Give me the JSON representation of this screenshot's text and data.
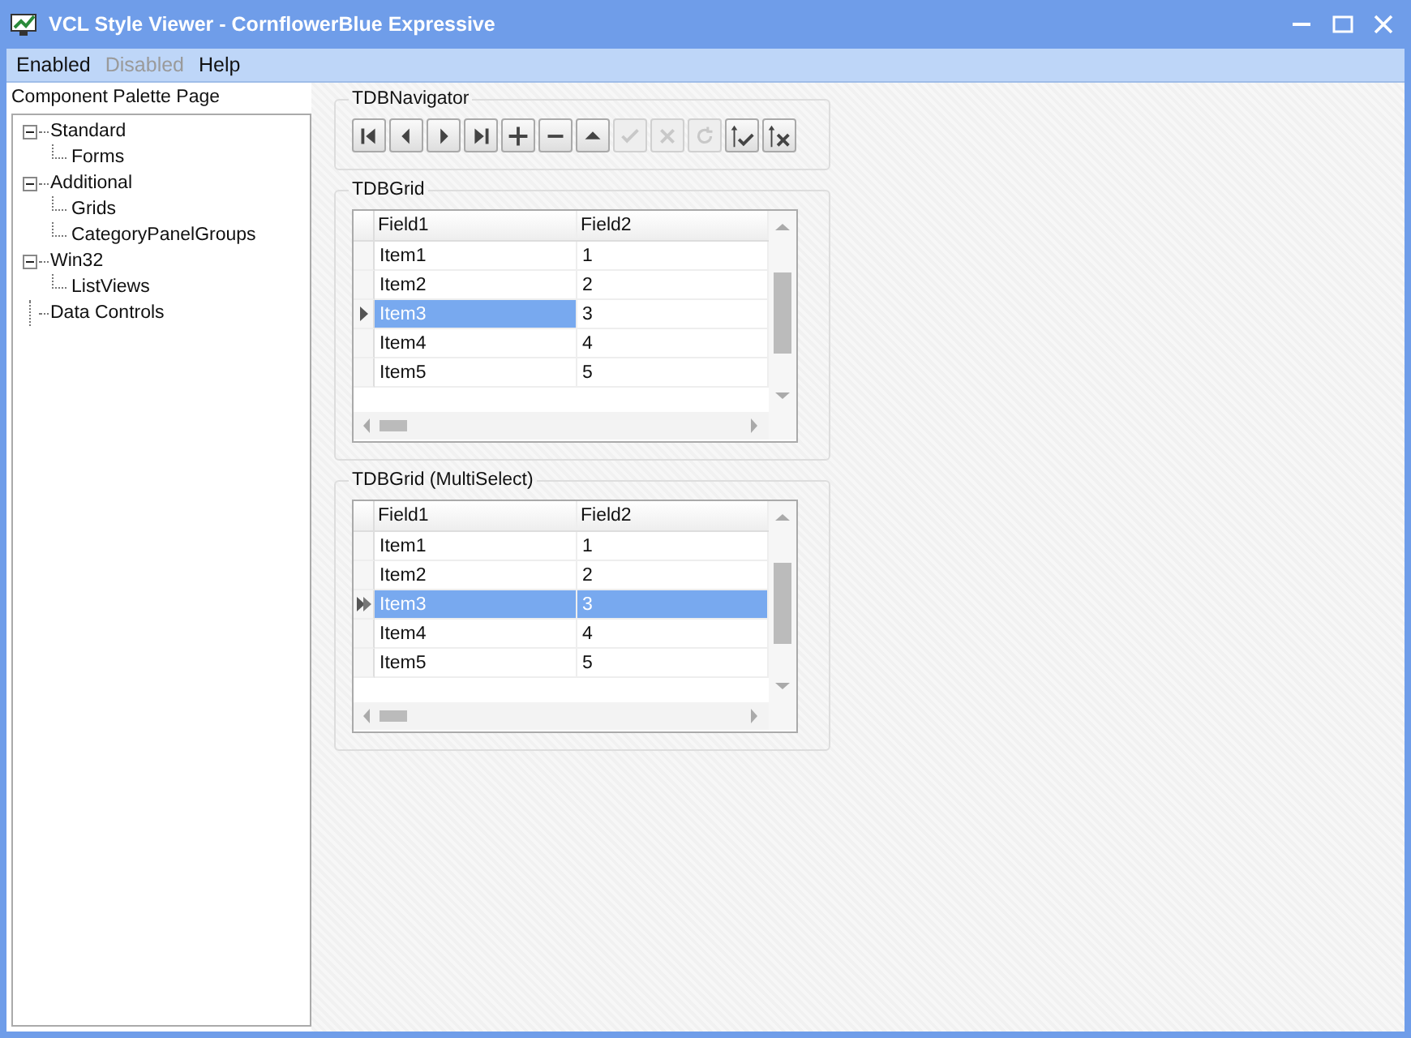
{
  "window": {
    "title": "VCL Style Viewer - CornflowerBlue Expressive"
  },
  "menu": [
    {
      "label": "Enabled",
      "disabled": false
    },
    {
      "label": "Disabled",
      "disabled": true
    },
    {
      "label": "Help",
      "disabled": false
    }
  ],
  "sidebar": {
    "title": "Component Palette Page",
    "tree": [
      {
        "label": "Standard",
        "expanded": true,
        "children": [
          {
            "label": "Forms"
          }
        ]
      },
      {
        "label": "Additional",
        "expanded": true,
        "children": [
          {
            "label": "Grids"
          },
          {
            "label": "CategoryPanelGroups"
          }
        ]
      },
      {
        "label": "Win32",
        "expanded": true,
        "children": [
          {
            "label": "ListViews"
          }
        ]
      },
      {
        "label": "Data Controls"
      }
    ]
  },
  "navigator": {
    "title": "TDBNavigator",
    "buttons": [
      {
        "kind": "first",
        "disabled": false
      },
      {
        "kind": "prior",
        "disabled": false
      },
      {
        "kind": "next",
        "disabled": false
      },
      {
        "kind": "last",
        "disabled": false
      },
      {
        "kind": "insert",
        "disabled": false
      },
      {
        "kind": "delete",
        "disabled": false
      },
      {
        "kind": "edit",
        "disabled": false
      },
      {
        "kind": "post",
        "disabled": true
      },
      {
        "kind": "cancel",
        "disabled": true
      },
      {
        "kind": "refresh",
        "disabled": true
      },
      {
        "kind": "apply",
        "disabled": false
      },
      {
        "kind": "discard",
        "disabled": false
      }
    ]
  },
  "grids": [
    {
      "title": "TDBGrid",
      "multiselect": false,
      "columns": [
        "Field1",
        "Field2"
      ],
      "rows": [
        {
          "cells": [
            "Item1",
            "1"
          ],
          "selected": false
        },
        {
          "cells": [
            "Item2",
            "2"
          ],
          "selected": false
        },
        {
          "cells": [
            "Item3",
            "3"
          ],
          "selected": true
        },
        {
          "cells": [
            "Item4",
            "4"
          ],
          "selected": false
        },
        {
          "cells": [
            "Item5",
            "5"
          ],
          "selected": false
        }
      ]
    },
    {
      "title": "TDBGrid (MultiSelect)",
      "multiselect": true,
      "columns": [
        "Field1",
        "Field2"
      ],
      "rows": [
        {
          "cells": [
            "Item1",
            "1"
          ],
          "selected": false
        },
        {
          "cells": [
            "Item2",
            "2"
          ],
          "selected": false
        },
        {
          "cells": [
            "Item3",
            "3"
          ],
          "selected": true
        },
        {
          "cells": [
            "Item4",
            "4"
          ],
          "selected": false
        },
        {
          "cells": [
            "Item5",
            "5"
          ],
          "selected": false
        }
      ]
    }
  ]
}
